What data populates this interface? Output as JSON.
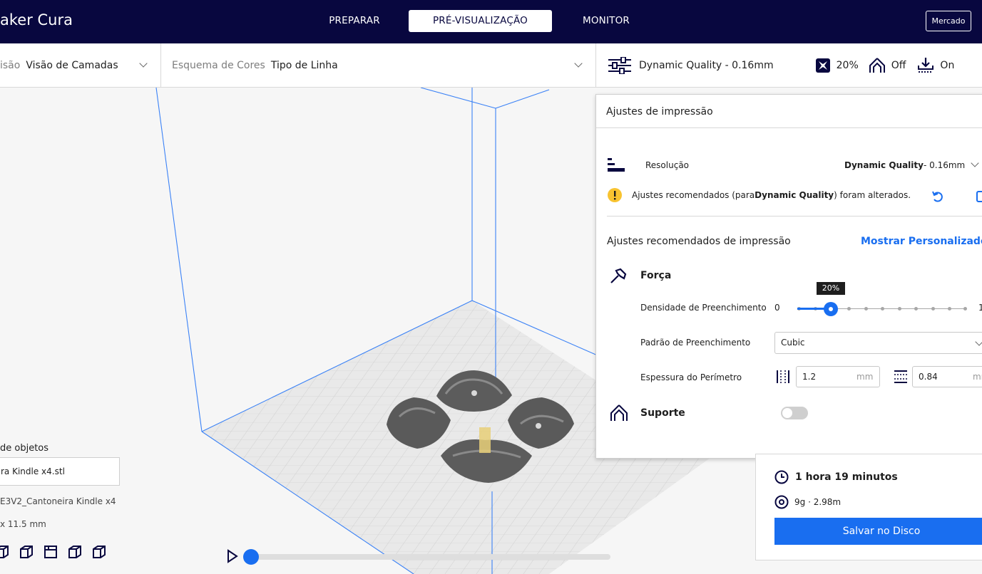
{
  "app": {
    "title": "aker Cura"
  },
  "stages": [
    {
      "label": "PREPARAR",
      "active": false
    },
    {
      "label": "PRÉ-VISUALIZAÇÃO",
      "active": true
    },
    {
      "label": "MONITOR",
      "active": false
    }
  ],
  "marketplace_label": "Mercado",
  "viewbar": {
    "view_label": "isão",
    "view_value": "Visão de Camadas",
    "color_label": "Esquema de Cores",
    "color_value": "Tipo de Linha",
    "profile": "Dynamic Quality - 0.16mm",
    "infill": "20%",
    "support": "Off",
    "adhesion": "On"
  },
  "print_settings": {
    "title": "Ajustes de impressão",
    "resolution_label": "Resolução",
    "resolution_value_bold": "Dynamic Quality",
    "resolution_value_rest": " - 0.16mm",
    "warning_prefix": "Ajustes recomendados (para ",
    "warning_bold": "Dynamic Quality",
    "warning_suffix": ") foram alterados.",
    "recommended_title": "Ajustes recomendados de impressão",
    "custom_link": "Mostrar Personalizado",
    "strength_label": "Força",
    "infill_density_label": "Densidade de Preenchimento",
    "infill_min": "0",
    "infill_max": "1",
    "infill_tooltip": "20%",
    "infill_fraction": 0.2,
    "infill_pattern_label": "Padrão de Preenchimento",
    "infill_pattern_value": "Cubic",
    "wall_thickness_label": "Espessura do Perímetro",
    "wall_thickness_value": "1.2",
    "wall_thickness_unit": "mm",
    "top_bottom_value": "0.84",
    "top_bottom_unit": "mm",
    "support_label": "Suporte",
    "support_enabled": false
  },
  "result": {
    "time": "1 hora 19 minutos",
    "material": "9g · 2.98m",
    "save_button": "Salvar no Disco"
  },
  "objects": {
    "title": "de objetos",
    "file": "ra Kindle x4.stl",
    "name": "E3V2_Cantoneira Kindle x4",
    "dims": "x 11.5 mm"
  },
  "colors": {
    "topbar": "#08073f",
    "accent": "#196ef0"
  }
}
